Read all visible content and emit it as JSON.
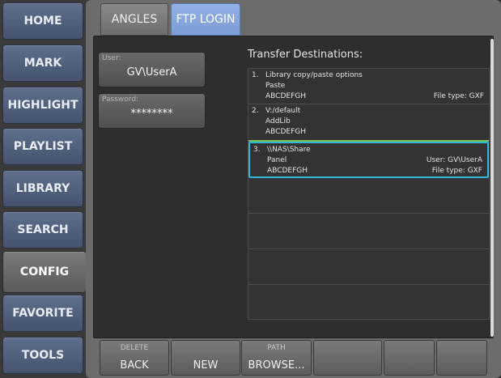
{
  "nav": {
    "items": [
      {
        "label": "HOME"
      },
      {
        "label": "MARK"
      },
      {
        "label": "HIGHLIGHT"
      },
      {
        "label": "PLAYLIST"
      },
      {
        "label": "LIBRARY"
      },
      {
        "label": "SEARCH"
      },
      {
        "label": "CONFIG",
        "active": true
      },
      {
        "label": "FAVORITE"
      },
      {
        "label": "TOOLS"
      }
    ]
  },
  "tabs": {
    "angles": "ANGLES",
    "ftp_login": "FTP LOGIN"
  },
  "credentials": {
    "user_label": "User:",
    "user_value": "GV\\UserA",
    "password_label": "Password:",
    "password_value": "********"
  },
  "transfer": {
    "title": "Transfer Destinations:",
    "destinations": [
      {
        "num": "1.",
        "line1": "Library copy/paste options",
        "line2": "Paste",
        "line3": "ABCDEFGH",
        "right2": "",
        "right3": "File type: GXF"
      },
      {
        "num": "2.",
        "line1": "V:/default",
        "line2": "AddLib",
        "line3": "ABCDEFGH",
        "right2": "",
        "right3": ""
      },
      {
        "num": "3.",
        "line1": "\\\\NAS\\Share",
        "line2": "Panel",
        "line3": "ABCDEFGH",
        "right2": "User: GV\\UserA",
        "right3": "File type: GXF"
      }
    ]
  },
  "actions": {
    "back": {
      "sub": "DELETE",
      "main": "BACK"
    },
    "new": {
      "sub": "",
      "main": "NEW"
    },
    "browse": {
      "sub": "PATH",
      "main": "BROWSE..."
    }
  },
  "colors": {
    "nav_button": "#4e5c78",
    "active_tab": "#7b9cd4",
    "selection_border": "#2fb6d8",
    "green_indicator": "#79c44a"
  }
}
